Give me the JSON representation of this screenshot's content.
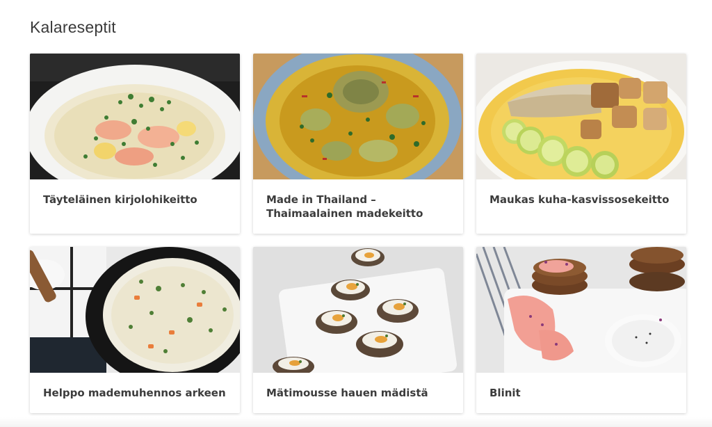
{
  "section": {
    "title": "Kalareseptit"
  },
  "recipes": [
    {
      "title": "Täyteläinen kirjolohikeitto",
      "image": "salmon-soup-image"
    },
    {
      "title": "Made in Thailand – Thaimaalainen madekeitto",
      "image": "thai-fish-curry-image"
    },
    {
      "title": "Maukas kuha-kasvissosekeitto",
      "image": "pikeperch-puree-soup-image"
    },
    {
      "title": "Helppo mademuhennos arkeen",
      "image": "burbot-stew-image"
    },
    {
      "title": "Mätimousse hauen mädistä",
      "image": "roe-mousse-canapes-image"
    },
    {
      "title": "Blinit",
      "image": "blini-image"
    }
  ]
}
